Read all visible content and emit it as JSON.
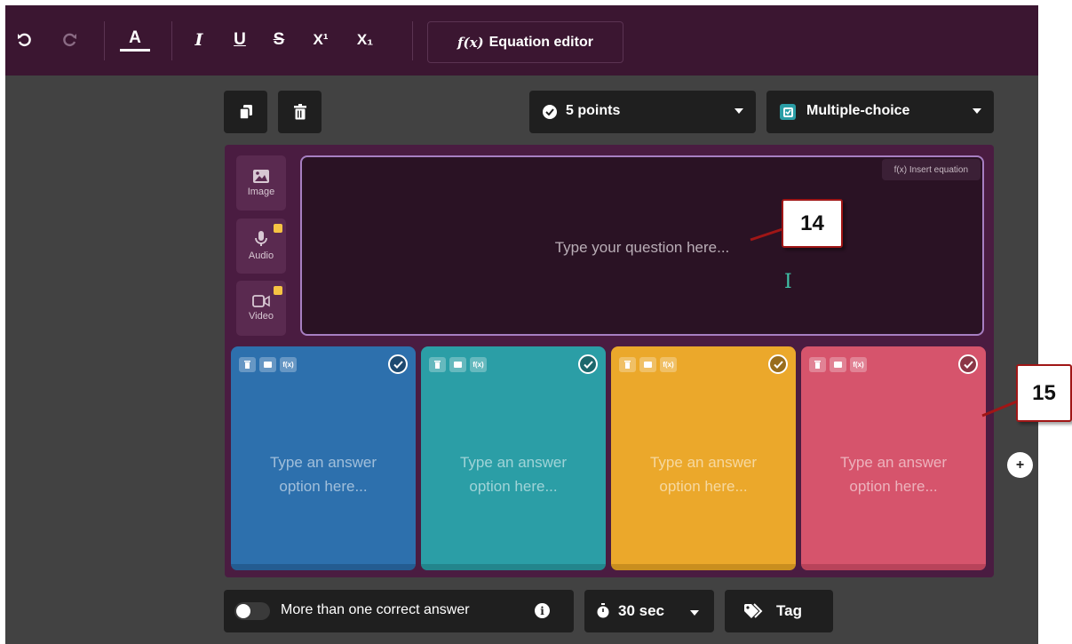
{
  "toolbar": {
    "undo_icon": "undo-icon",
    "redo_icon": "redo-icon",
    "font_color_label": "A",
    "italic_label": "I",
    "underline_label": "U",
    "strike_label": "S",
    "superscript_label": "X¹",
    "subscript_label": "X₁",
    "equation_editor_fx": "f(x)",
    "equation_editor_label": "Equation editor"
  },
  "actions": {
    "duplicate_icon": "copy-icon",
    "delete_icon": "trash-icon",
    "points_label": "5 points",
    "question_type_label": "Multiple-choice"
  },
  "question": {
    "media": [
      {
        "label": "Image",
        "icon": "image-icon"
      },
      {
        "label": "Audio",
        "icon": "microphone-icon"
      },
      {
        "label": "Video",
        "icon": "video-icon"
      }
    ],
    "insert_equation_label": "f(x) Insert equation",
    "placeholder": "Type your question here...",
    "cursor_glyph": "I"
  },
  "answers": {
    "placeholder_line1": "Type an answer",
    "placeholder_line2": "option here...",
    "tool_fx": "f(x)",
    "options": [
      {
        "color": "#2d70ad",
        "bottom": "#245c91"
      },
      {
        "color": "#2b9ea6",
        "bottom": "#23858c"
      },
      {
        "color": "#eba82b",
        "bottom": "#c98e1f"
      },
      {
        "color": "#d6546c",
        "bottom": "#b8435a"
      }
    ],
    "add_label": "+"
  },
  "bottom_bar": {
    "multi_correct_label": "More than one correct answer",
    "timer_label": "30 sec",
    "tag_label": "Tag"
  },
  "callouts": {
    "question_callout": "14",
    "answers_callout": "15"
  }
}
